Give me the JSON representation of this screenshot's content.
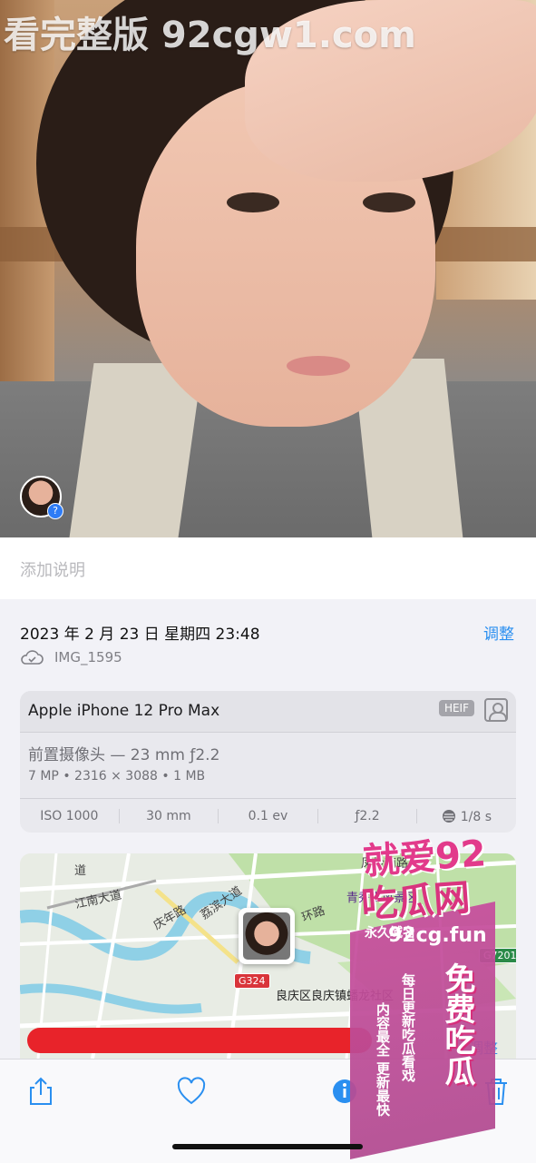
{
  "photo_watermark": "看完整版 92cgw1.com",
  "face_badge_symbol": "?",
  "caption_placeholder": "添加说明",
  "info": {
    "date": "2023 年 2 月 23 日 星期四 23:48",
    "adjust_label": "调整",
    "filename": "IMG_1595"
  },
  "camera": {
    "device": "Apple iPhone 12 Pro Max",
    "format_badge": "HEIF",
    "lens": "前置摄像头 — 23 mm ƒ2.2",
    "specs": "7 MP • 2316 × 3088 • 1 MB",
    "exif": [
      "ISO 1000",
      "30 mm",
      "0.1 ev",
      "ƒ2.2",
      "1/8 s"
    ]
  },
  "map": {
    "labels": {
      "jiangnan": "江南大道",
      "dao": "道",
      "qingnian": "庆年路",
      "lihu": "荔滨大道",
      "huanlu": "环路",
      "fengyan": "凤岭南路",
      "scenic": "青秀山风景区",
      "area": "良庆区良庆镇蟠龙社区"
    },
    "shields": [
      "G324",
      "G7201"
    ],
    "adjust_label": "调整"
  },
  "overlay_watermark": {
    "line1": "就爱92",
    "line2": "吃瓜网",
    "domain_tag": "永久域名",
    "domain": "92cg.fun",
    "slogan1": "每日更新吃瓜看戏",
    "slogan2": "内容最全 更新最快",
    "slogan3": "免费吃瓜"
  },
  "toolbar_icons": [
    "share-icon",
    "heart-icon",
    "info-icon",
    "trash-icon"
  ],
  "colors": {
    "accent": "#2a8ff0",
    "redact": "#e8232a"
  }
}
